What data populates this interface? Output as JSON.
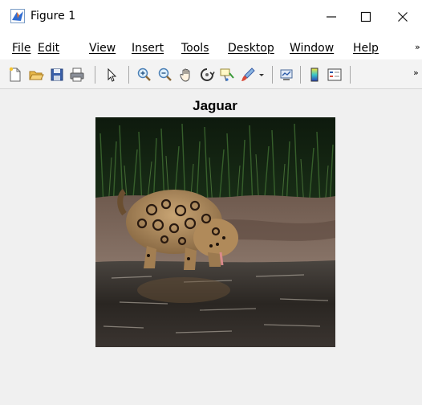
{
  "window": {
    "title": "Figure 1",
    "app_icon": "matlab-icon",
    "controls": [
      "minimize-icon",
      "maximize-icon",
      "close-icon"
    ]
  },
  "menubar": {
    "items": [
      {
        "label": "File"
      },
      {
        "label": "Edit"
      },
      {
        "label": "View"
      },
      {
        "label": "Insert"
      },
      {
        "label": "Tools"
      },
      {
        "label": "Desktop"
      },
      {
        "label": "Window"
      },
      {
        "label": "Help"
      }
    ],
    "overflow_icon": "chevron-right-double-icon"
  },
  "toolbar": {
    "buttons": [
      "new-figure-icon",
      "open-file-icon",
      "save-icon",
      "print-icon",
      "pointer-icon",
      "zoom-in-icon",
      "zoom-out-icon",
      "pan-icon",
      "rotate-3d-icon",
      "data-cursor-icon",
      "brush-icon",
      "dropdown-arrow-icon",
      "link-plot-icon",
      "colorbar-icon",
      "legend-icon"
    ],
    "overflow_icon": "chevron-right-double-icon"
  },
  "figure": {
    "plot_title": "Jaguar",
    "image_subject": "jaguar-drinking-water-photo"
  },
  "colors": {
    "titlebar_bg": "#ffffff",
    "figure_bg": "#f0f0f0",
    "toolbar_bg": "#f3f3f3"
  }
}
